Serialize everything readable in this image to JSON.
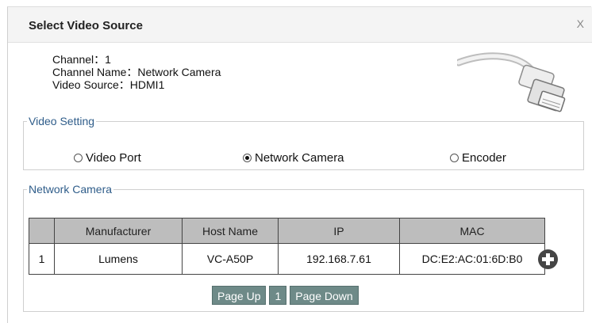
{
  "dialog": {
    "title": "Select Video Source",
    "close_label": "X"
  },
  "info": {
    "channel": "Channel：1",
    "channel_name": "Channel Name：Network Camera",
    "video_source": "Video Source：HDMI1"
  },
  "video_setting": {
    "legend": "Video Setting",
    "options": [
      {
        "label": "Video Port",
        "selected": false
      },
      {
        "label": "Network Camera",
        "selected": true
      },
      {
        "label": "Encoder",
        "selected": false
      }
    ]
  },
  "network_camera": {
    "legend": "Network Camera",
    "columns": [
      "",
      "Manufacturer",
      "Host Name",
      "IP",
      "MAC"
    ],
    "rows": [
      [
        "1",
        "Lumens",
        "VC-A50P",
        "192.168.7.61",
        "DC:E2:AC:01:6D:B0"
      ]
    ],
    "add_icon": "plus-circle-icon",
    "pager": {
      "prev_label": "Page Up",
      "page": "1",
      "next_label": "Page Down"
    }
  },
  "colors": {
    "legend_text": "#2f5d8a",
    "header_bg": "#bdbdbd",
    "pager_bg": "#6e8a88",
    "add_icon": "#454545"
  }
}
